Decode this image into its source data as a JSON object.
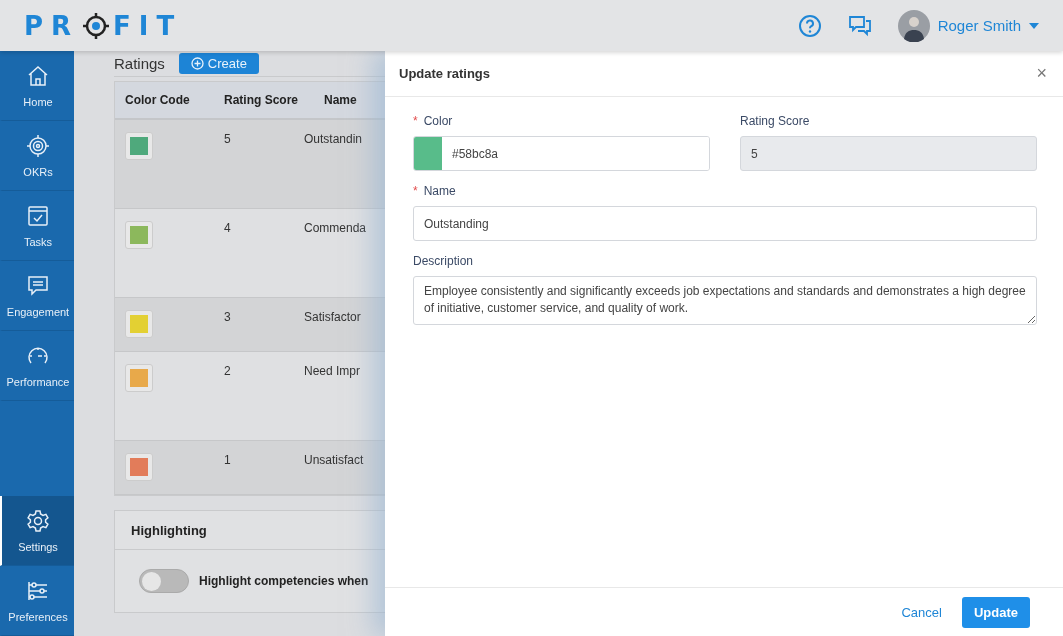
{
  "logo": {
    "before": "PR",
    "after": "FIT"
  },
  "header": {
    "user": "Roger Smith"
  },
  "sidebar": {
    "items": [
      {
        "label": "Home",
        "selected": false
      },
      {
        "label": "OKRs",
        "selected": false
      },
      {
        "label": "Tasks",
        "selected": false
      },
      {
        "label": "Engagement",
        "selected": false
      },
      {
        "label": "Performance",
        "selected": false
      }
    ],
    "bottom_items": [
      {
        "label": "Settings",
        "selected": true
      },
      {
        "label": "Preferences",
        "selected": false
      }
    ]
  },
  "ratings": {
    "title": "Ratings",
    "create_button": "Create",
    "columns": [
      "Color Code",
      "Rating Score",
      "Name"
    ],
    "rows": [
      {
        "color": "#4fa97c",
        "score": "5",
        "name": "Outstandin",
        "tall": true
      },
      {
        "color": "#8cb85c",
        "score": "4",
        "name": "Commenda",
        "tall": true
      },
      {
        "color": "#e3d033",
        "score": "3",
        "name": "Satisfactor",
        "tall": false
      },
      {
        "color": "#e8a94a",
        "score": "2",
        "name": "Need Impr",
        "tall": true
      },
      {
        "color": "#e27c5a",
        "score": "1",
        "name": "Unsatisfact",
        "tall": false
      }
    ]
  },
  "highlighting": {
    "title": "Highlighting",
    "toggle_label": "Highlight competencies when",
    "on": false
  },
  "drawer": {
    "title": "Update ratings",
    "close": "×",
    "color": {
      "label": "Color",
      "required_mark": "*",
      "color": "#58bc8a",
      "value": "#58bc8a"
    },
    "rating_score": {
      "label": "Rating Score",
      "value": "5",
      "disabled": true
    },
    "name": {
      "label": "Name",
      "required_mark": "*",
      "value": "Outstanding"
    },
    "description": {
      "label": "Description",
      "value": "Employee consistently and significantly exceeds job expectations and standards and demonstrates a high degree of initiative, customer service, and quality of work."
    },
    "buttons": {
      "cancel": "Cancel",
      "update": "Update"
    }
  }
}
